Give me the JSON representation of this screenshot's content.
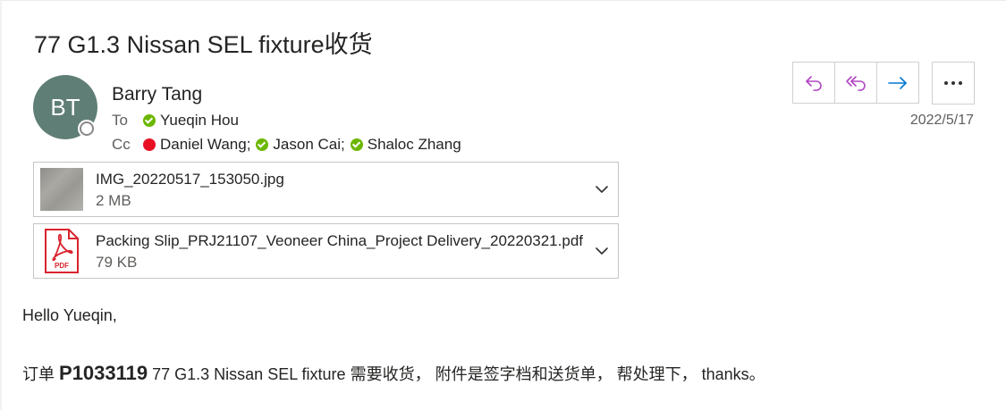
{
  "email": {
    "subject": "77 G1.3 Nissan SEL fixture收货",
    "sender": {
      "initials": "BT",
      "name": "Barry Tang"
    },
    "to_label": "To",
    "cc_label": "Cc",
    "to": [
      {
        "name": "Yueqin Hou",
        "status": "available"
      }
    ],
    "cc": [
      {
        "name": "Daniel Wang;",
        "status": "busy"
      },
      {
        "name": "Jason Cai;",
        "status": "available"
      },
      {
        "name": "Shaloc Zhang",
        "status": "available"
      }
    ],
    "date": "2022/5/17"
  },
  "actions": {
    "reply_icon": "reply-icon",
    "reply_all_icon": "reply-all-icon",
    "forward_icon": "forward-icon",
    "more_icon": "more-icon"
  },
  "attachments": [
    {
      "name": "IMG_20220517_153050.jpg",
      "size": "2 MB",
      "type": "image"
    },
    {
      "name": "Packing Slip_PRJ21107_Veoneer China_Project Delivery_20220321.pdf",
      "size": "79 KB",
      "type": "pdf",
      "badge": "PDF"
    }
  ],
  "body": {
    "greeting": "Hello Yueqin,",
    "prefix": "订单 ",
    "order": "P1033119",
    "text": " 77 G1.3 Nissan SEL fixture 需要收货， 附件是签字档和送货单， 帮处理下， thanks。"
  },
  "colors": {
    "avatar": "#5f7e76",
    "reply_accent": "#b146c2",
    "forward_accent": "#0078d4",
    "available": "#6bb700",
    "busy": "#e81123",
    "pdf_red": "#d9232e"
  }
}
